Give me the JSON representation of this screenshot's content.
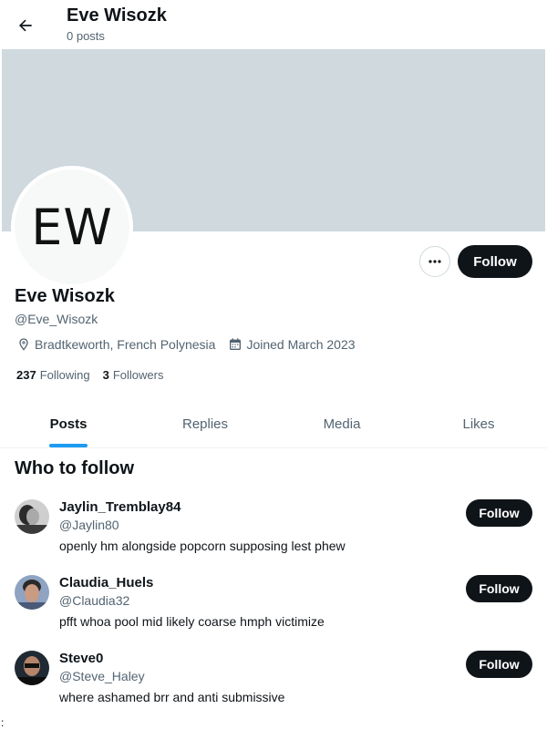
{
  "header": {
    "title": "Eve Wisozk",
    "posts_count": "0 posts"
  },
  "profile": {
    "avatar_initials": "EW",
    "name": "Eve Wisozk",
    "handle": "@Eve_Wisozk",
    "location": "Bradtkeworth, French Polynesia",
    "joined": "Joined March 2023",
    "following_count": "237",
    "following_label": "Following",
    "followers_count": "3",
    "followers_label": "Followers",
    "follow_label": "Follow"
  },
  "tabs": [
    {
      "label": "Posts",
      "active": true
    },
    {
      "label": "Replies",
      "active": false
    },
    {
      "label": "Media",
      "active": false
    },
    {
      "label": "Likes",
      "active": false
    }
  ],
  "who_to_follow": {
    "title": "Who to follow",
    "users": [
      {
        "name": "Jaylin_Tremblay84",
        "handle": "@Jaylin80",
        "bio": "openly hm alongside popcorn supposing lest phew",
        "follow_label": "Follow"
      },
      {
        "name": "Claudia_Huels",
        "handle": "@Claudia32",
        "bio": "pfft whoa pool mid likely coarse hmph victimize",
        "follow_label": "Follow"
      },
      {
        "name": "Steve0",
        "handle": "@Steve_Haley",
        "bio": "where ashamed brr and anti submissive",
        "follow_label": "Follow"
      }
    ]
  },
  "stray_char": ":",
  "colors": {
    "banner": "#cfd9de",
    "accent": "#1d9bf0",
    "button_dark": "#0f1419",
    "secondary_text": "#536471"
  },
  "icons": {
    "back": "arrow-left-icon",
    "more": "ellipsis-icon",
    "location": "location-pin-icon",
    "calendar": "calendar-icon"
  }
}
